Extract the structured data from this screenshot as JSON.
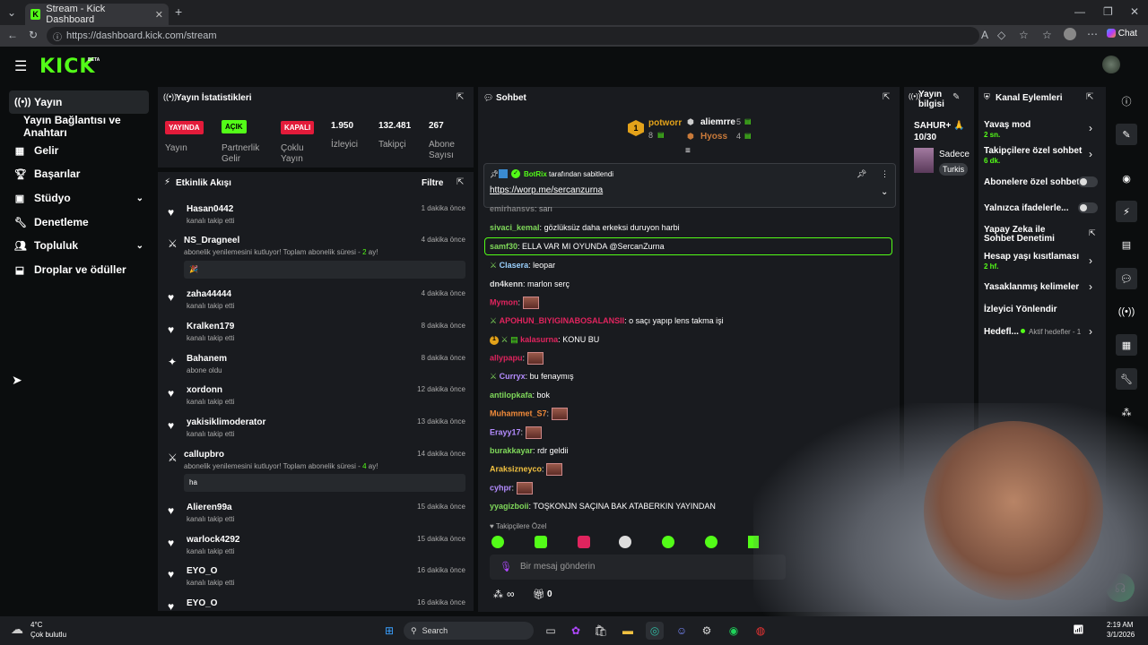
{
  "browser": {
    "tab_title": "Stream - Kick Dashboard",
    "url": "https://dashboard.kick.com/stream",
    "copilot_label": "Chat"
  },
  "brand": {
    "logo": "KICK",
    "beta": "BETA"
  },
  "sidebar": {
    "items": [
      {
        "label": "Yayın",
        "icon": "broadcast-icon"
      },
      {
        "label": "Yayın Bağlantısı ve Anahtarı",
        "icon": ""
      },
      {
        "label": "Gelir",
        "icon": "revenue-icon"
      },
      {
        "label": "Başarılar",
        "icon": "trophy-icon"
      },
      {
        "label": "Stüdyo",
        "icon": "studio-icon"
      },
      {
        "label": "Denetleme",
        "icon": "wrench-icon"
      },
      {
        "label": "Topluluk",
        "icon": "community-icon"
      },
      {
        "label": "Droplar ve ödüller",
        "icon": "drops-icon"
      }
    ]
  },
  "stats": {
    "title": "Yayın İstatistikleri",
    "badges": [
      {
        "text": "YAYINDA",
        "label": "Yayın",
        "color": "#e31b3a"
      },
      {
        "text": "AÇIK",
        "label": "Partnerlik\nGelir",
        "color": "#53fc18"
      },
      {
        "text": "KAPALI",
        "label": "Çoklu\nYayın",
        "color": "#e31b3a"
      }
    ],
    "values": [
      {
        "value": "1.950",
        "label": "İzleyici"
      },
      {
        "value": "132.481",
        "label": "Takipçi"
      },
      {
        "value": "267",
        "label": "Abone\nSayısı"
      }
    ]
  },
  "activity": {
    "title": "Etkinlik Akışı",
    "filter": "Filtre",
    "items": [
      {
        "name": "Hasan0442",
        "sub": "kanalı takip etti",
        "time": "1 dakika önce",
        "icon": "heart-icon"
      },
      {
        "name": "NS_Dragneel",
        "sub": "abonelik yenilemesini kutluyor! Toplam abonelik süresi - ",
        "months": "2",
        "unit": " ay!",
        "time": "4 dakika önce",
        "icon": "sub-icon",
        "box": "🎉"
      },
      {
        "name": "zaha44444",
        "sub": "kanalı takip etti",
        "time": "4 dakika önce",
        "icon": "heart-icon"
      },
      {
        "name": "Kralken179",
        "sub": "kanalı takip etti",
        "time": "8 dakika önce",
        "icon": "heart-icon"
      },
      {
        "name": "Bahanem",
        "sub": "abone oldu",
        "time": "8 dakika önce",
        "icon": "sparkle-icon"
      },
      {
        "name": "xordonn",
        "sub": "kanalı takip etti",
        "time": "12 dakika önce",
        "icon": "heart-icon"
      },
      {
        "name": "yakisiklimoderator",
        "sub": "kanalı takip etti",
        "time": "13 dakika önce",
        "icon": "heart-icon"
      },
      {
        "name": "callupbro",
        "sub": "abonelik yenilemesini kutluyor! Toplam abonelik süresi - ",
        "months": "4",
        "unit": " ay!",
        "time": "14 dakika önce",
        "icon": "sub-icon",
        "box": "ha"
      },
      {
        "name": "Alieren99a",
        "sub": "kanalı takip etti",
        "time": "15 dakika önce",
        "icon": "heart-icon"
      },
      {
        "name": "warlock4292",
        "sub": "kanalı takip etti",
        "time": "15 dakika önce",
        "icon": "heart-icon"
      },
      {
        "name": "EYO_O",
        "sub": "kanalı takip etti",
        "time": "16 dakika önce",
        "icon": "heart-icon"
      },
      {
        "name": "EYO_O",
        "sub": "",
        "time": "16 dakika önce",
        "icon": "heart-icon"
      }
    ]
  },
  "chat": {
    "title": "Sohbet",
    "leaders": [
      {
        "rank": "1",
        "name": "potworr",
        "count": "8"
      },
      {
        "name": "aliemrre",
        "count": "5"
      },
      {
        "name": "Hyoss",
        "count": "4"
      }
    ],
    "pinned": {
      "by": "BotRix",
      "suffix": "tarafından sabitlendi",
      "link": "https://worp.me/sercanzurna"
    },
    "messages": [
      {
        "user": "emirhansvs",
        "text": " sarı",
        "color": "#bbb"
      },
      {
        "user": "sivaci_kemal",
        "text": " gözlüksüz daha erkeksi duruyon harbi",
        "color": "#7fd85a"
      },
      {
        "user": "samf30",
        "text": " ELLA VAR MI OYUNDA @SercanZurna",
        "color": "#7fd85a"
      },
      {
        "user": "Clasera",
        "text": " leopar",
        "color": "#9ad1ff"
      },
      {
        "user": "dn4kenn",
        "text": " marlon serç",
        "color": "#dddddd"
      },
      {
        "user": "Mymon",
        "text": "",
        "color": "#e0245e"
      },
      {
        "user": "APOHUN_BIYIGINABOSALANSII",
        "text": " o saçı yapıp lens takma işi",
        "color": "#e0245e"
      },
      {
        "user": "kalasurna",
        "text": " KONU BU",
        "color": "#e0245e"
      },
      {
        "user": "allypapu",
        "text": "",
        "color": "#e0245e"
      },
      {
        "user": "Curryx",
        "text": " bu fenaymış",
        "color": "#b48cff"
      },
      {
        "user": "antilopkafa",
        "text": " bok",
        "color": "#7fd85a"
      },
      {
        "user": "Muhammet_S7",
        "text": "",
        "color": "#f08a3a"
      },
      {
        "user": "Erayy17",
        "text": "",
        "color": "#b48cff"
      },
      {
        "user": "burakkayar",
        "text": " rdr geldii",
        "color": "#7fd85a"
      },
      {
        "user": "Araksizneyco",
        "text": "",
        "color": "#f0c040"
      },
      {
        "user": "cyhpr",
        "text": "",
        "color": "#b48cff"
      },
      {
        "user": "yyagizboii",
        "text": " TOŞKONJN SAÇINA BAK ATABERKIN YAYINDAN",
        "color": "#7fd85a"
      }
    ],
    "followers_only": "Takipçilere Özel",
    "placeholder": "Bir mesaj gönderin",
    "infinity": "∞",
    "count": "0"
  },
  "broadcast_info": {
    "title": "Yayın bilgisi",
    "stream_title": "SAHUR+ 🙏 10/30",
    "category": "Sadece",
    "tag": "Turkis"
  },
  "channel_actions": {
    "title": "Kanal Eylemleri",
    "items": [
      {
        "label": "Yavaş mod",
        "sub": "2 sn.",
        "control": "chevron"
      },
      {
        "label": "Takipçilere özel sohbet",
        "sub": "6 dk.",
        "control": "chevron"
      },
      {
        "label": "Abonelere özel sohbet",
        "sub": "",
        "control": "toggle"
      },
      {
        "label": "Yalnızca ifadelerle...",
        "sub": "",
        "control": "toggle"
      },
      {
        "label": "Yapay Zeka ile Sohbet Denetimi",
        "sub": "",
        "control": "external"
      },
      {
        "label": "Hesap yaşı kısıtlaması",
        "sub": "2 hf.",
        "control": "chevron"
      },
      {
        "label": "Yasaklanmış kelimeler",
        "sub": "",
        "control": "chevron"
      },
      {
        "label": "İzleyici Yönlendir",
        "sub": "",
        "control": ""
      },
      {
        "label": "Hedefl...",
        "sub": "Aktif hedefler - 1",
        "control": "chevron"
      }
    ]
  },
  "taskbar": {
    "weather_temp": "4°C",
    "weather_desc": "Çok bulutlu",
    "search": "Search",
    "time": "2:19 AM",
    "date": "3/1/2026"
  },
  "colors": {
    "accent": "#53fc18",
    "panel": "#191b1f",
    "background": "#0b0d0e"
  }
}
